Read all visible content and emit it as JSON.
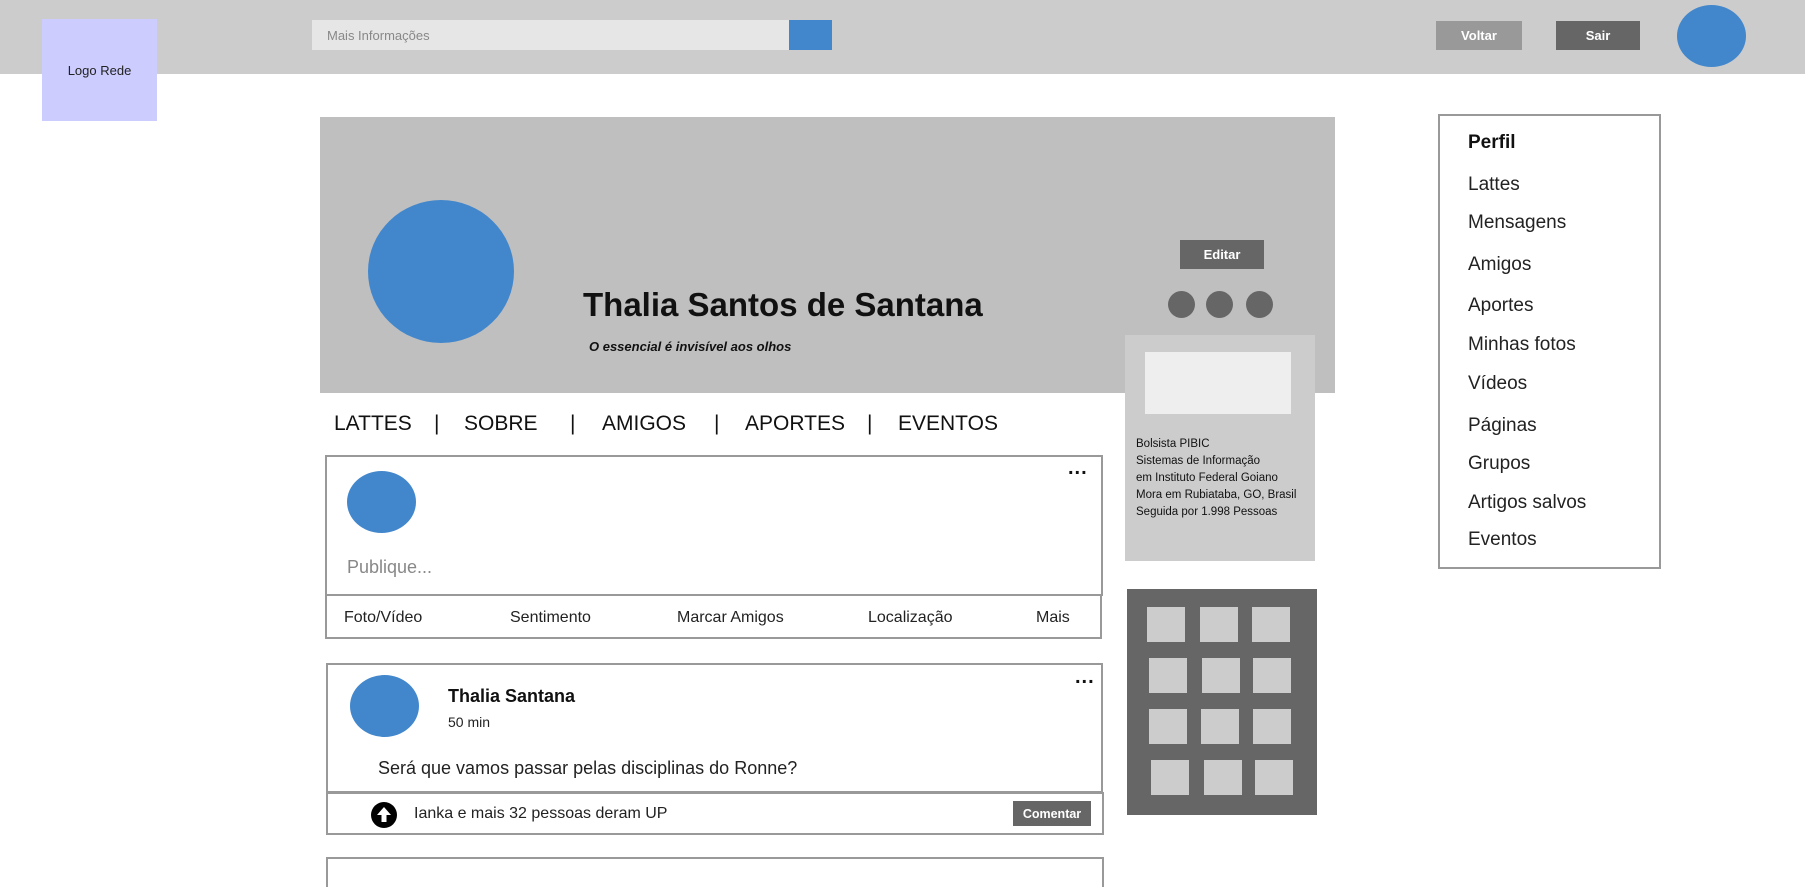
{
  "header": {
    "logo_label": "Logo Rede",
    "search_placeholder": "Mais Informações",
    "back_label": "Voltar",
    "exit_label": "Sair"
  },
  "profile": {
    "name": "Thalia Santos de Santana",
    "quote": "O essencial é invisível aos olhos",
    "edit_label": "Editar",
    "info": [
      "Bolsista PIBIC",
      "Sistemas de Informação",
      "em Instituto Federal Goiano",
      "Mora em Rubiataba, GO, Brasil",
      "Seguida por 1.998 Pessoas"
    ]
  },
  "tabs": [
    "LATTES",
    "|",
    "SOBRE",
    "|",
    "AMIGOS",
    "|",
    "APORTES",
    "|",
    "EVENTOS"
  ],
  "composer": {
    "more_label": "...",
    "placeholder": "Publique...",
    "actions": [
      "Foto/Vídeo",
      "Sentimento",
      "Marcar Amigos",
      "Localização",
      "Mais"
    ]
  },
  "post": {
    "more_label": "...",
    "author": "Thalia Santana",
    "time": "50 min",
    "text": "Será que vamos passar pelas disciplinas do Ronne?",
    "ups_text": "Ianka e mais 32 pessoas deram UP",
    "comment_label": "Comentar"
  },
  "side_menu": {
    "title": "Perfil",
    "items": [
      "Lattes",
      "Mensagens",
      "Amigos",
      "Aportes",
      "Minhas fotos",
      "Vídeos",
      "Páginas",
      "Grupos",
      "Artigos salvos",
      "Eventos"
    ]
  },
  "colors": {
    "accent_blue": "#4287cc",
    "top_bar": "#cccccc",
    "logo_bg": "#ccccff",
    "dark_button": "#666666",
    "light_button": "#999999"
  }
}
